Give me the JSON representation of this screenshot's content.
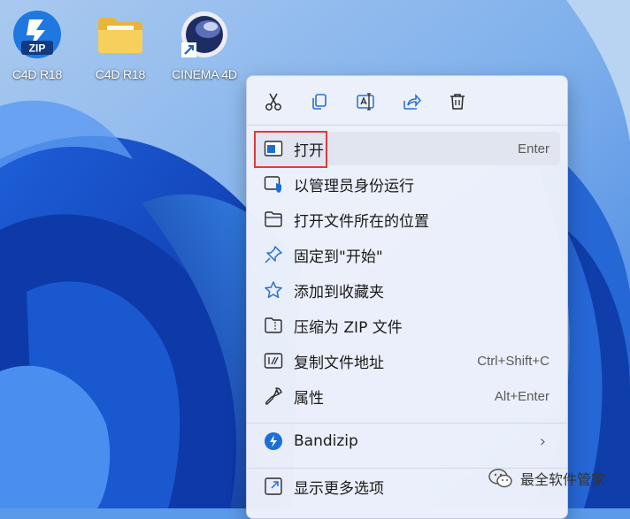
{
  "desktop": {
    "icons": [
      {
        "label": "C4D R18",
        "icon": "zip-archive-icon"
      },
      {
        "label": "C4D R18",
        "icon": "folder-icon"
      },
      {
        "label": "CINEMA 4D",
        "icon": "cinema4d-shortcut-icon"
      }
    ]
  },
  "context_menu": {
    "quick_actions": [
      {
        "name": "cut",
        "icon": "scissors-icon"
      },
      {
        "name": "copy",
        "icon": "copy-icon"
      },
      {
        "name": "rename",
        "icon": "rename-icon"
      },
      {
        "name": "share",
        "icon": "share-icon"
      },
      {
        "name": "delete",
        "icon": "trash-icon"
      }
    ],
    "items": [
      {
        "label": "打开",
        "shortcut": "Enter",
        "icon": "open-window-icon",
        "hovered": true
      },
      {
        "label": "以管理员身份运行",
        "shortcut": "",
        "icon": "shield-run-icon"
      },
      {
        "label": "打开文件所在的位置",
        "shortcut": "",
        "icon": "folder-open-icon"
      },
      {
        "label": "固定到\"开始\"",
        "shortcut": "",
        "icon": "pin-icon"
      },
      {
        "label": "添加到收藏夹",
        "shortcut": "",
        "icon": "star-icon"
      },
      {
        "label": "压缩为 ZIP 文件",
        "shortcut": "",
        "icon": "zip-folder-icon"
      },
      {
        "label": "复制文件地址",
        "shortcut": "Ctrl+Shift+C",
        "icon": "copy-path-icon"
      },
      {
        "label": "属性",
        "shortcut": "Alt+Enter",
        "icon": "wrench-icon"
      }
    ],
    "bandizip": {
      "label": "Bandizip",
      "icon": "bandizip-icon",
      "chevron": "›"
    },
    "more": {
      "label": "显示更多选项",
      "icon": "expand-icon"
    }
  },
  "watermark": {
    "text": "最全软件管家",
    "icon": "wechat-icon"
  },
  "colors": {
    "highlight_border": "#e23a3a",
    "accent_blue": "#1a6fd6",
    "menu_background": "#eef2fb"
  }
}
